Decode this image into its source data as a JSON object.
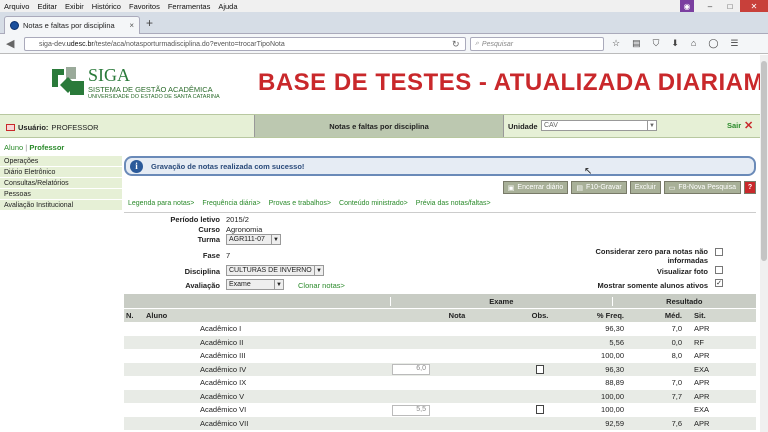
{
  "menu": [
    "Arquivo",
    "Editar",
    "Exibir",
    "Histórico",
    "Favoritos",
    "Ferramentas",
    "Ajuda"
  ],
  "tab": {
    "title": "Notas e faltas por disciplina",
    "close": "×",
    "new": "+"
  },
  "url": {
    "host": "siga-dev.",
    "domain": "udesc.br",
    "path": "/teste/aca/notasporturmadisciplina.do?evento=trocarTipoNota"
  },
  "search": {
    "placeholder": "Pesquisar"
  },
  "banner": {
    "logo": "SIGA",
    "subtitle1": "SISTEMA DE GESTÃO ACADÊMICA",
    "subtitle2": "UNIVERSIDADE DO ESTADO DE SANTA CATARINA",
    "title": "BASE DE TESTES - ATUALIZADA DIARIAMEI"
  },
  "header": {
    "user_label": "Usuário:",
    "user_name": "PROFESSOR",
    "center_title": "Notas e faltas por disciplina",
    "unidade_label": "Unidade",
    "unidade_value": "CAV",
    "sair": "Sair"
  },
  "roles": {
    "aluno": "Aluno",
    "sep": "|",
    "professor": "Professor"
  },
  "sidebar": [
    "Operações",
    "Diário Eletrônico",
    "Consultas/Relatórios",
    "Pessoas",
    "Avaliação Institucional"
  ],
  "alert": {
    "icon": "i",
    "message": "Gravação de notas realizada com sucesso!"
  },
  "actions": {
    "encerrar": "Encerrar diário",
    "gravar": "F10-Gravar",
    "excluir": "Excluir",
    "nova": "F8-Nova Pesquisa",
    "help": "?"
  },
  "links": [
    "Legenda para notas>",
    "Frequência diária>",
    "Provas e trabalhos>",
    "Conteúdo ministrado>",
    "Prévia das notas/faltas>"
  ],
  "form": {
    "periodo_label": "Período letivo",
    "periodo": "2015/2",
    "curso_label": "Curso",
    "curso": "Agronomia",
    "turma_label": "Turma",
    "turma": "AGR111-07",
    "fase_label": "Fase",
    "fase": "7",
    "disciplina_label": "Disciplina",
    "disciplina": "CULTURAS DE INVERNO",
    "avaliacao_label": "Avaliação",
    "avaliacao": "Exame",
    "clonar": "Clonar notas>",
    "zero_label1": "Considerar zero para notas não",
    "zero_label2": "informadas",
    "foto_label": "Visualizar foto",
    "ativos_label": "Mostrar somente alunos ativos",
    "ativos_check": "✓"
  },
  "table": {
    "group_exame": "Exame",
    "group_resultado": "Resultado",
    "headers": {
      "n": "N.",
      "aluno": "Aluno",
      "nota": "Nota",
      "obs": "Obs.",
      "freq": "% Freq.",
      "med": "Méd.",
      "sit": "Sit."
    },
    "rows": [
      {
        "aluno": "Acadêmico I",
        "nota": "",
        "obs": false,
        "freq": "96,30",
        "med": "7,0",
        "sit": "APR"
      },
      {
        "aluno": "Acadêmico II",
        "nota": "",
        "obs": false,
        "freq": "5,56",
        "med": "0,0",
        "sit": "RF"
      },
      {
        "aluno": "Acadêmico III",
        "nota": "",
        "obs": false,
        "freq": "100,00",
        "med": "8,0",
        "sit": "APR"
      },
      {
        "aluno": "Acadêmico IV",
        "nota": "6,0",
        "obs": true,
        "freq": "96,30",
        "med": "",
        "sit": "EXA"
      },
      {
        "aluno": "Acadêmico IX",
        "nota": "",
        "obs": false,
        "freq": "88,89",
        "med": "7,0",
        "sit": "APR"
      },
      {
        "aluno": "Acadêmico V",
        "nota": "",
        "obs": false,
        "freq": "100,00",
        "med": "7,7",
        "sit": "APR"
      },
      {
        "aluno": "Acadêmico VI",
        "nota": "5,5",
        "obs": true,
        "freq": "100,00",
        "med": "",
        "sit": "EXA"
      },
      {
        "aluno": "Acadêmico VII",
        "nota": "",
        "obs": false,
        "freq": "92,59",
        "med": "7,6",
        "sit": "APR"
      }
    ]
  },
  "colors": {
    "brand_green": "#2a7a3a",
    "title_red": "#c9282b",
    "header_bg": "#e6f0d6",
    "alert_border": "#6a8ab8"
  }
}
